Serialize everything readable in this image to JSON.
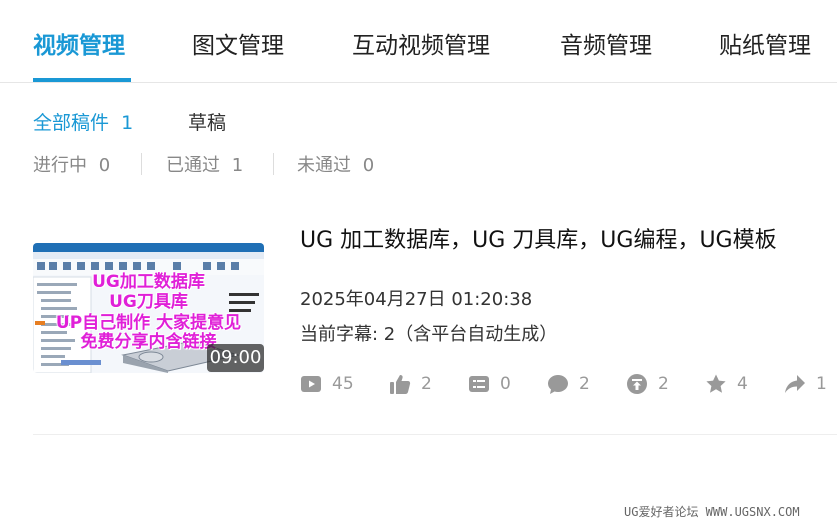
{
  "tabs": [
    {
      "label": "视频管理",
      "active": true
    },
    {
      "label": "图文管理",
      "active": false
    },
    {
      "label": "互动视频管理",
      "active": false
    },
    {
      "label": "音频管理",
      "active": false
    },
    {
      "label": "贴纸管理",
      "active": false
    }
  ],
  "filters": {
    "all": {
      "label": "全部稿件",
      "count": "1"
    },
    "draft": {
      "label": "草稿"
    }
  },
  "status": [
    {
      "label": "进行中",
      "count": "0"
    },
    {
      "label": "已通过",
      "count": "1"
    },
    {
      "label": "未通过",
      "count": "0"
    }
  ],
  "video": {
    "thumbnail_overlay": [
      "UG加工数据库",
      "UG刀具库",
      "UP自己制作 大家提意见",
      "免费分享内含链接"
    ],
    "duration": "09:00",
    "title": "UG 加工数据库，UG 刀具库，UG编程，UG模板",
    "date": "2025年04月27日 01:20:38",
    "subtitle_info": "当前字幕: 2（含平台自动生成）",
    "stats": {
      "play": "45",
      "like": "2",
      "danmaku": "0",
      "comment": "2",
      "coin": "2",
      "favorite": "4",
      "share": "1"
    }
  },
  "watermark": "UG爱好者论坛 WWW.UGSNX.COM",
  "colors": {
    "accent": "#1a98d5",
    "overlay_text": "#e020d8",
    "muted": "#999999"
  },
  "icons": [
    "play-icon",
    "like-icon",
    "danmaku-icon",
    "comment-icon",
    "coin-icon",
    "favorite-icon",
    "share-icon"
  ]
}
